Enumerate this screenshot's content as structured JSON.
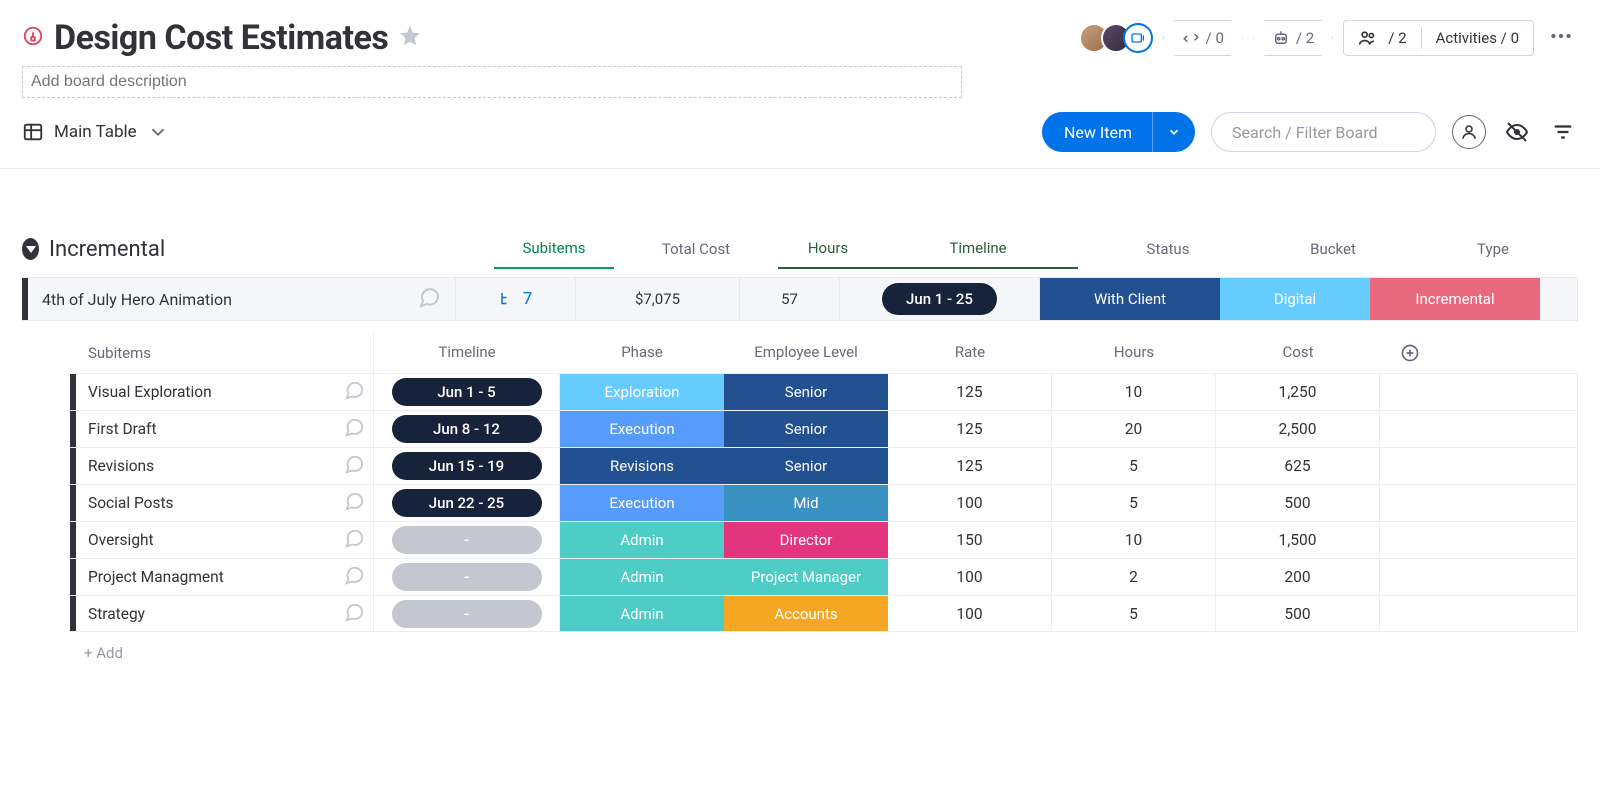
{
  "header": {
    "title": "Design Cost Estimates",
    "description_placeholder": "Add board description",
    "integrations_count": "/ 0",
    "automations_count": "/ 2",
    "members_count": "/ 2",
    "activities_label": "Activities / 0"
  },
  "view": {
    "name": "Main Table",
    "new_item_label": "New Item",
    "search_placeholder": "Search / Filter Board"
  },
  "group": {
    "name": "Incremental",
    "columns": {
      "subitems": "Subitems",
      "total_cost": "Total Cost",
      "hours": "Hours",
      "timeline": "Timeline",
      "status": "Status",
      "bucket": "Bucket",
      "type": "Type"
    },
    "item": {
      "name": "4th of July Hero Animation",
      "subitems_count": "7",
      "total_cost": "$7,075",
      "hours": "57",
      "timeline": "Jun 1 - 25",
      "status": "With Client",
      "bucket": "Digital",
      "type": "Incremental"
    }
  },
  "sub_columns": {
    "subitems": "Subitems",
    "timeline": "Timeline",
    "phase": "Phase",
    "employee_level": "Employee Level",
    "rate": "Rate",
    "hours": "Hours",
    "cost": "Cost"
  },
  "subitems": [
    {
      "name": "Visual Exploration",
      "timeline": "Jun 1 - 5",
      "phase": "Exploration",
      "phase_color": "#66ccff",
      "emp": "Senior",
      "emp_color": "#225091",
      "rate": "125",
      "hours": "10",
      "cost": "1,250"
    },
    {
      "name": "First Draft",
      "timeline": "Jun 8 - 12",
      "phase": "Execution",
      "phase_color": "#579bfc",
      "emp": "Senior",
      "emp_color": "#225091",
      "rate": "125",
      "hours": "20",
      "cost": "2,500"
    },
    {
      "name": "Revisions",
      "timeline": "Jun 15 - 19",
      "phase": "Revisions",
      "phase_color": "#225091",
      "emp": "Senior",
      "emp_color": "#225091",
      "rate": "125",
      "hours": "5",
      "cost": "625"
    },
    {
      "name": "Social Posts",
      "timeline": "Jun 22 - 25",
      "phase": "Execution",
      "phase_color": "#579bfc",
      "emp": "Mid",
      "emp_color": "#3991c2",
      "rate": "100",
      "hours": "5",
      "cost": "500"
    },
    {
      "name": "Oversight",
      "timeline": "-",
      "phase": "Admin",
      "phase_color": "#4eccc6",
      "emp": "Director",
      "emp_color": "#e2357e",
      "rate": "150",
      "hours": "10",
      "cost": "1,500"
    },
    {
      "name": "Project Managment",
      "timeline": "-",
      "phase": "Admin",
      "phase_color": "#4eccc6",
      "emp": "Project Manager",
      "emp_color": "#4eccc6",
      "rate": "100",
      "hours": "2",
      "cost": "200"
    },
    {
      "name": "Strategy",
      "timeline": "-",
      "phase": "Admin",
      "phase_color": "#4eccc6",
      "emp": "Accounts",
      "emp_color": "#f5a623",
      "rate": "100",
      "hours": "5",
      "cost": "500"
    }
  ],
  "add_row_label": "+ Add"
}
